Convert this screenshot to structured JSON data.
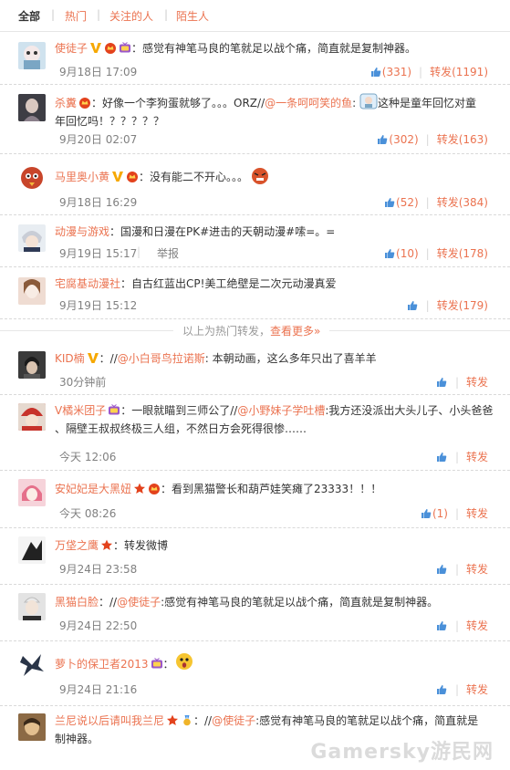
{
  "tabs": [
    "全部",
    "热门",
    "关注的人",
    "陌生人"
  ],
  "hot_divider": {
    "text": "以上为热门转发，",
    "more": "查看更多»"
  },
  "report_label": "举报",
  "repost_label": "转发",
  "watermark": "Gamersky游民网",
  "items": [
    {
      "name": "使徒子",
      "text": "：感觉有神笔马良的笔就足以战个痛，简直就是复制神器。",
      "time": "9月18日 17:09",
      "likes": "(331)",
      "reposts": "转发(1191)"
    },
    {
      "name": "杀糞",
      "text_a": "：好像一个李狗蛋就够了。。。ORZ//",
      "mention": "@一条呵呵笑的鱼",
      "text_b": ":",
      "text_c": "这种是童年回忆对童",
      "text_d": "年回忆吗！？？？？？",
      "time": "9月20日 02:07",
      "likes": "(302)",
      "reposts": "转发(163)"
    },
    {
      "name": "马里奥小黄",
      "text": "：没有能二不开心。。。",
      "time": "9月18日 16:29",
      "likes": "(52)",
      "reposts": "转发(384)"
    },
    {
      "name": "动漫与游戏",
      "text": "：国漫和日漫在PK#进击的天朝动漫#嗦=。=",
      "time": "9月19日 15:17",
      "report": "举报",
      "likes": "(10)",
      "reposts": "转发(178)"
    },
    {
      "name": "宅腐基动漫社",
      "text": "：自古红蓝出CP!美工绝壁是二次元动漫真爱",
      "time": "9月19日 15:12",
      "likes": "",
      "reposts": "转发(179)"
    },
    {
      "name": "KID楠",
      "text_a": "：//",
      "mention": "@小白哥鸟拉诺斯",
      "text_b": ": 本朝动画，这么多年只出了喜羊羊",
      "time": "30分钟前",
      "likes": "",
      "reposts": "转发"
    },
    {
      "name": "V橘米团子",
      "text_a": "：一眼就瞄到三师公了//",
      "mention": "@小野妹子学吐槽",
      "text_b": ":我方还没派出大头儿子、小头爸爸",
      "text_c": "、隔壁王叔叔终极三人组，不然日方会死得很惨……",
      "time": "今天 12:06",
      "likes": "",
      "reposts": "转发"
    },
    {
      "name": "安妃妃是大黑妞",
      "text": "：看到黑猫警长和葫芦娃笑瘫了23333！！！",
      "time": "今天 08:26",
      "likes": "(1)",
      "reposts": "转发"
    },
    {
      "name": "万垡之鹰",
      "text": "：转发微博",
      "time": "9月24日 23:58",
      "likes": "",
      "reposts": "转发"
    },
    {
      "name": "黑猫白脸",
      "text_a": "：//",
      "mention": "@使徒子",
      "text_b": ":感觉有神笔马良的笔就足以战个痛，简直就是复制神器。",
      "time": "9月24日 22:50",
      "likes": "",
      "reposts": "转发"
    },
    {
      "name": "萝卜的保卫者2013",
      "text": "：",
      "time": "9月24日 21:16",
      "likes": "",
      "reposts": "转发"
    },
    {
      "name": "兰尼说以后请叫我兰尼",
      "text_a": "：//",
      "mention": "@使徒子",
      "text_b": ":感觉有神笔马良的笔就足以战个痛，简直就是",
      "text_c": "制神器。",
      "time": "",
      "likes": "",
      "reposts": ""
    }
  ],
  "colors": {
    "accent": "#eb7350",
    "time": "#808080",
    "text": "#333333",
    "dashed": "#d9d9d9"
  }
}
